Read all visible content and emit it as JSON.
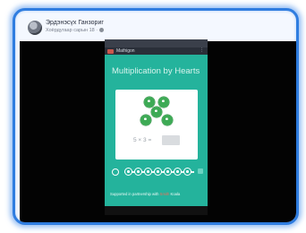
{
  "post": {
    "author": "Эрдэнэсүх Ганзориг",
    "meta": "Хоёрдугаар сарын 18 ·"
  },
  "phone": {
    "app_name": "Mathigon",
    "menu_icon": "more-icon",
    "game_title": "Multiplication by Hearts",
    "equation": "5 × 3 =",
    "answer": "",
    "progress_steps": 7,
    "footer_text_prefix": "Supported in partnership with",
    "footer_text_highlight": "Smith",
    "footer_text_suffix": "Koala"
  },
  "colors": {
    "frame_border": "#2f7de0",
    "phone_bg": "#24b39c",
    "apple": "#3daa55"
  }
}
